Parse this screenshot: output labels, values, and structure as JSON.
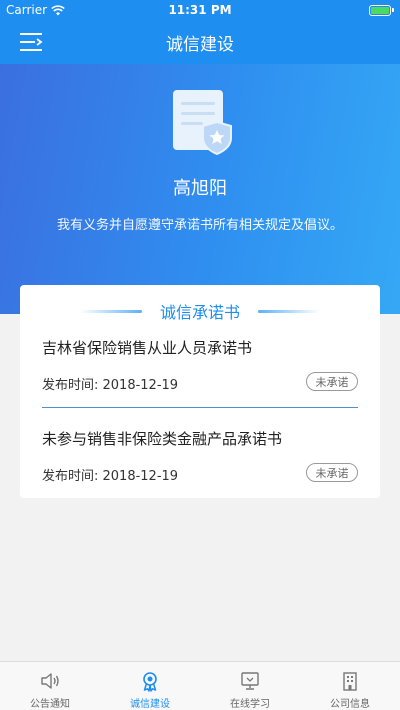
{
  "status_bar": {
    "carrier": "Carrier",
    "time": "11:31 PM"
  },
  "nav": {
    "title": "诚信建设",
    "menu_icon": "menu-icon"
  },
  "hero": {
    "icon": "certificate-icon",
    "name": "高旭阳",
    "pledge": "我有义务并自愿遵守承诺书所有相关规定及倡议。"
  },
  "card": {
    "title": "诚信承诺书",
    "items": [
      {
        "title": "吉林省保险销售从业人员承诺书",
        "date": "发布时间: 2018-12-19",
        "status": "未承诺"
      },
      {
        "title": "未参与销售非保险类金融产品承诺书",
        "date": "发布时间: 2018-12-19",
        "status": "未承诺"
      }
    ]
  },
  "tabs": [
    {
      "label": "公告通知",
      "icon": "speaker-icon",
      "active": false
    },
    {
      "label": "诚信建设",
      "icon": "badge-icon",
      "active": true
    },
    {
      "label": "在线学习",
      "icon": "monitor-icon",
      "active": false
    },
    {
      "label": "公司信息",
      "icon": "building-icon",
      "active": false
    }
  ],
  "colors": {
    "primary": "#1e8ef0",
    "tab_inactive": "#666666",
    "divider": "#4f8fcf"
  }
}
